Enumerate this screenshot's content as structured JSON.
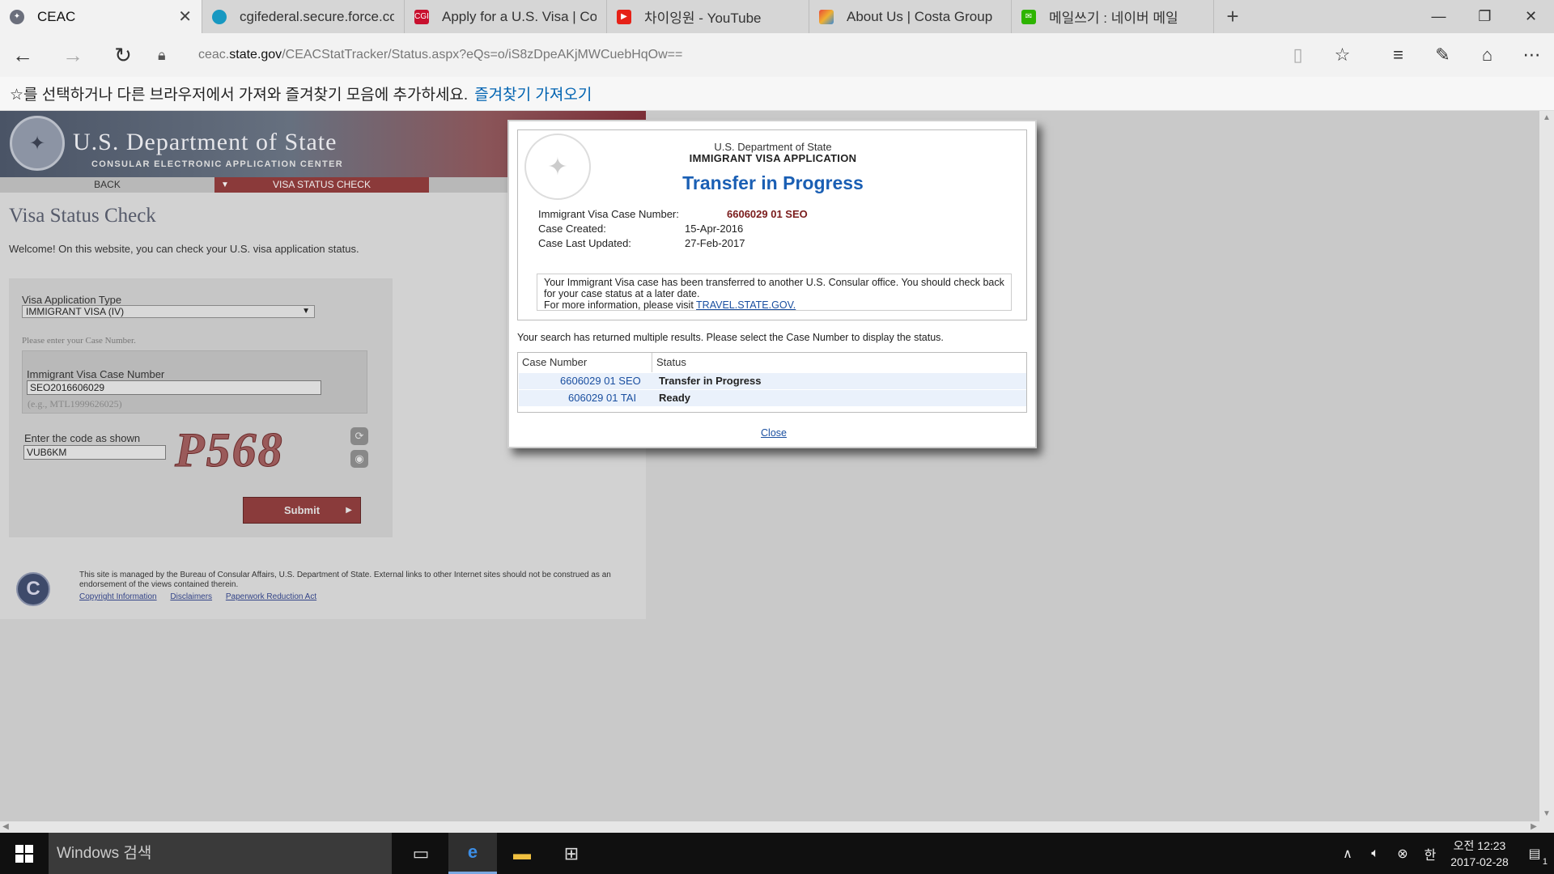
{
  "browser": {
    "tabs": [
      {
        "title": "CEAC",
        "icon": "seal-icon",
        "color": "#555",
        "active": true
      },
      {
        "title": "cgifederal.secure.force.com",
        "icon": "cloud-icon",
        "color": "#1798c1",
        "active": false
      },
      {
        "title": "Apply for a U.S. Visa | Conta",
        "icon": "cgi-icon",
        "color": "#c8102e",
        "active": false
      },
      {
        "title": "차이잉원 - YouTube",
        "icon": "youtube-icon",
        "color": "#e62117",
        "active": false
      },
      {
        "title": "About Us | Costa Group",
        "icon": "costa-icon",
        "color": "#f0a030",
        "active": false
      },
      {
        "title": "메일쓰기 : 네이버 메일",
        "icon": "naver-mail-icon",
        "color": "#2db400",
        "active": false
      }
    ],
    "url_prefix": "ceac.",
    "url_domain": "state.gov",
    "url_path": "/CEACStatTracker/Status.aspx?eQs=o/iS8zDpeAKjMWCuebHqOw==",
    "favbar_text": "☆를 선택하거나 다른 브라우저에서 가져와 즐겨찾기 모음에 추가하세요.",
    "favbar_link": "즐겨찾기 가져오기"
  },
  "site": {
    "dept": "U.S. Department of State",
    "center": "CONSULAR ELECTRONIC APPLICATION CENTER",
    "nav_back": "BACK",
    "nav_vsc": "VISA STATUS CHECK",
    "title": "Visa Status Check",
    "welcome": "Welcome! On this website, you can check your U.S. visa application status.",
    "form": {
      "type_label": "Visa Application Type",
      "type_value": "IMMIGRANT VISA (IV)",
      "instruction": "Please enter your Case Number.",
      "case_label": "Immigrant Visa Case Number",
      "case_value": "SEO2016606029",
      "case_hint": "(e.g., MTL1999626025)",
      "code_label": "Enter the code as shown",
      "code_value": "VUB6KM",
      "captcha": "P568",
      "submit": "Submit"
    },
    "footer": {
      "text": "This site is managed by the Bureau of Consular Affairs, U.S. Department of State. External links to other Internet sites should not be construed as an endorsement of the views contained therein.",
      "links": [
        "Copyright Information",
        "Disclaimers",
        "Paperwork Reduction Act"
      ]
    }
  },
  "modal": {
    "org": "U.S. Department of State",
    "app": "IMMIGRANT VISA APPLICATION",
    "status": "Transfer in Progress",
    "case_label": "Immigrant Visa Case Number:",
    "case_value": "6606029 01 SEO",
    "created_label": "Case Created:",
    "created_value": "15-Apr-2016",
    "updated_label": "Case Last Updated:",
    "updated_value": "27-Feb-2017",
    "message": "Your Immigrant Visa case has been transferred to another U.S. Consular office. You should check back for your case status at a later date.",
    "more_info": "For more information, please visit",
    "more_link": "TRAVEL.STATE.GOV.",
    "multi": "Your search has returned multiple results. Please select the Case Number to display the status.",
    "table": {
      "headers": [
        "Case Number",
        "Status"
      ],
      "rows": [
        {
          "case": "6606029 01 SEO",
          "status": "Transfer in Progress"
        },
        {
          "case": "606029 01 TAI",
          "status": "Ready"
        }
      ]
    },
    "close": "Close"
  },
  "taskbar": {
    "search": "Windows 검색",
    "ime": "한",
    "time": "오전 12:23",
    "date": "2017-02-28",
    "notif_count": "1"
  }
}
